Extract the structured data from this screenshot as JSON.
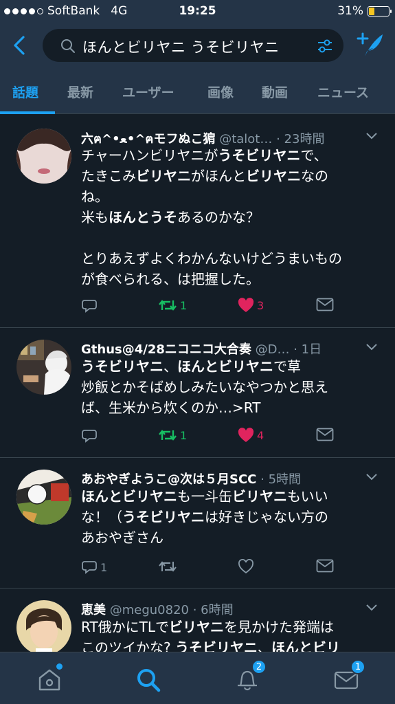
{
  "status_bar": {
    "carrier": "SoftBank",
    "network": "4G",
    "time": "19:25",
    "battery": "31%",
    "battery_fraction": 0.31,
    "signal_bars": 4
  },
  "header": {
    "back_icon": "chevron-left-icon",
    "search_query": "ほんとビリヤニ うそビリヤニ",
    "filter_icon": "filter-icon",
    "compose_icon": "compose-icon"
  },
  "tabs": [
    "話題",
    "最新",
    "ユーザー",
    "画像",
    "動画",
    "ニュース"
  ],
  "active_tab": "話題",
  "tweets": [
    {
      "name": "六ฅ^•ﻌ•^ฅモフぬこ猏",
      "handle": "@talot…",
      "time": "· 23時間",
      "body_lines": [
        [
          {
            "t": "チャーハンビリヤニが"
          },
          {
            "t": "うそビリヤニ",
            "b": true
          },
          {
            "t": "で、"
          }
        ],
        [
          {
            "t": "たきこみ"
          },
          {
            "t": "ビリヤニ",
            "b": true
          },
          {
            "t": "がほんと"
          },
          {
            "t": "ビリヤニ",
            "b": true
          },
          {
            "t": "なの"
          }
        ],
        [
          {
            "t": "ね。"
          }
        ],
        [
          {
            "t": "米も"
          },
          {
            "t": "ほんとうそ",
            "b": true
          },
          {
            "t": "あるのかな？"
          }
        ],
        [
          {
            "t": " "
          }
        ],
        [
          {
            "t": "とりあえずよくわかんないけどうまいもの"
          }
        ],
        [
          {
            "t": "が食べられる、は把握した。"
          }
        ]
      ],
      "reply_count": "",
      "retweet_count": "1",
      "like_count": "3",
      "liked": true,
      "retweeted": true
    },
    {
      "name": "Gthus@4/28ニコニコ大合奏",
      "handle": "@D…",
      "time": "· 1日",
      "body_lines": [
        [
          {
            "t": "うそビリヤニ",
            "b": true
          },
          {
            "t": "、"
          },
          {
            "t": "ほんとビリヤニ",
            "b": true
          },
          {
            "t": "で草"
          }
        ],
        [
          {
            "t": "炒飯とかそばめしみたいなやつかと思え"
          }
        ],
        [
          {
            "t": "ば、生米から炊くのか…>RT"
          }
        ]
      ],
      "reply_count": "",
      "retweet_count": "1",
      "like_count": "4",
      "liked": true,
      "retweeted": true
    },
    {
      "name": "あおやぎようこ@次は５月SCC",
      "handle": "",
      "time": "· 5時間",
      "body_lines": [
        [
          {
            "t": "ほんとビリヤニ",
            "b": true
          },
          {
            "t": "も一斗缶"
          },
          {
            "t": "ビリヤニ",
            "b": true
          },
          {
            "t": "もいい"
          }
        ],
        [
          {
            "t": "な！（"
          },
          {
            "t": "うそビリヤニ",
            "b": true
          },
          {
            "t": "は好きじゃない方の"
          }
        ],
        [
          {
            "t": "あおやぎさん"
          }
        ]
      ],
      "reply_count": "1",
      "retweet_count": "",
      "like_count": "",
      "liked": false,
      "retweeted": false
    },
    {
      "name": "恵美",
      "handle": "@megu0820",
      "time": "· 6時間",
      "body_lines": [
        [
          {
            "t": "RT俄かにTLで"
          },
          {
            "t": "ビリヤニ",
            "b": true
          },
          {
            "t": "を見かけた発端は"
          }
        ],
        [
          {
            "t": "このツイかな? "
          },
          {
            "t": "うそビリヤニ",
            "b": true
          },
          {
            "t": "、"
          },
          {
            "t": "ほんとビリ",
            "b": true
          }
        ]
      ],
      "reply_count": "",
      "retweet_count": "",
      "like_count": "",
      "liked": false,
      "retweeted": false
    }
  ],
  "bottom_nav": {
    "items": [
      "home-icon",
      "search-icon",
      "notifications-icon",
      "messages-icon"
    ],
    "notifications_badge": "2",
    "messages_badge": "1"
  },
  "colors": {
    "background": "#141d26",
    "bar": "#243447",
    "accent": "#1da1f2",
    "retweet": "#17bf63",
    "like": "#e0245e",
    "muted": "#8899a6"
  }
}
